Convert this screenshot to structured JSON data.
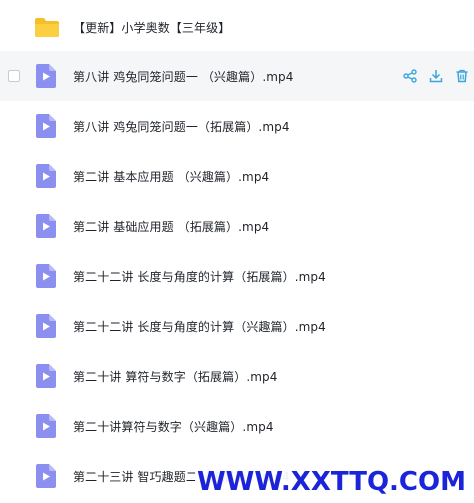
{
  "folder": {
    "name": "【更新】小学奥数【三年级】",
    "icon": "folder-icon"
  },
  "files": [
    {
      "name": "第八讲 鸡兔同笼问题一 （兴趣篇）.mp4",
      "icon": "video-file-icon"
    },
    {
      "name": "第八讲 鸡兔同笼问题一（拓展篇）.mp4",
      "icon": "video-file-icon"
    },
    {
      "name": "第二讲 基本应用题 （兴趣篇）.mp4",
      "icon": "video-file-icon"
    },
    {
      "name": "第二讲 基础应用题 （拓展篇）.mp4",
      "icon": "video-file-icon"
    },
    {
      "name": "第二十二讲 长度与角度的计算（拓展篇）.mp4",
      "icon": "video-file-icon"
    },
    {
      "name": "第二十二讲 长度与角度的计算（兴趣篇）.mp4",
      "icon": "video-file-icon"
    },
    {
      "name": "第二十讲 算符与数字（拓展篇）.mp4",
      "icon": "video-file-icon"
    },
    {
      "name": "第二十讲算符与数字（兴趣篇）.mp4",
      "icon": "video-file-icon"
    },
    {
      "name": "第二十三讲 智巧趣题二（拓展篇）.mp4",
      "icon": "video-file-icon"
    }
  ],
  "row_actions": {
    "share": "share-icon",
    "download": "download-icon",
    "delete": "trash-icon"
  },
  "colors": {
    "accent": "#3aa6d9",
    "file_icon": "#8a8ff0",
    "folder": "#f5bf2a",
    "watermark": "#1b24d8"
  },
  "watermark": "WWW.XXTTQ.COM"
}
